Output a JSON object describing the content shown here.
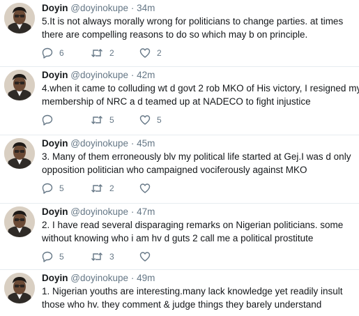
{
  "icons": {
    "reply": "reply-icon",
    "retweet": "retweet-icon",
    "like": "heart-icon"
  },
  "colors": {
    "icon": "#657786",
    "divider": "#e6ecf0"
  },
  "tweets": [
    {
      "name": "Doyin",
      "handle": "@doyinokupe",
      "separator": "·",
      "time": "34m",
      "lines": [
        "5.It is not always morally wrong for politicians to change parties. at times",
        "there are compelling reasons to do so which may b on principle."
      ],
      "replies": "6",
      "retweets": "2",
      "likes": "2"
    },
    {
      "name": "Doyin",
      "handle": "@doyinokupe",
      "separator": "·",
      "time": "42m",
      "lines": [
        "4.when it came to colluding wt d govt 2 rob MKO of His victory, I resigned my",
        "membership of NRC a d teamed up at NADECO to fight injustice"
      ],
      "replies": "",
      "retweets": "5",
      "likes": "5"
    },
    {
      "name": "Doyin",
      "handle": "@doyinokupe",
      "separator": "·",
      "time": "45m",
      "lines": [
        "3. Many of them erroneously blv my political life started at Gej.I was d only",
        "opposition politician who campaigned vociferously against MKO"
      ],
      "replies": "5",
      "retweets": "2",
      "likes": ""
    },
    {
      "name": "Doyin",
      "handle": "@doyinokupe",
      "separator": "·",
      "time": "47m",
      "lines": [
        "2. I have read several disparaging remarks on Nigerian politicians. some",
        "without knowing who i am hv d guts 2 call me a political prostitute"
      ],
      "replies": "5",
      "retweets": "3",
      "likes": ""
    },
    {
      "name": "Doyin",
      "handle": "@doyinokupe",
      "separator": "·",
      "time": "49m",
      "lines": [
        "1. Nigerian youths are interesting.many lack knowledge yet readily insult",
        "those who hv. they comment & judge things they barely understand"
      ]
    }
  ]
}
